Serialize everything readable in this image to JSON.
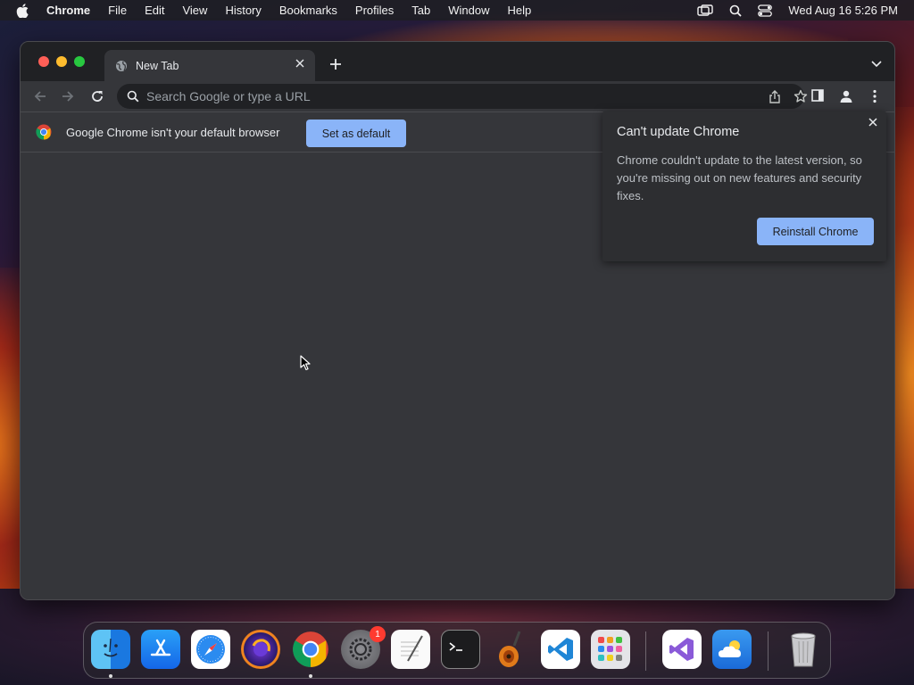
{
  "menubar": {
    "app_name": "Chrome",
    "items": [
      "File",
      "Edit",
      "View",
      "History",
      "Bookmarks",
      "Profiles",
      "Tab",
      "Window",
      "Help"
    ],
    "clock": "Wed Aug 16  5:26 PM"
  },
  "browser": {
    "tab_title": "New Tab",
    "omnibox_placeholder": "Search Google or type a URL"
  },
  "infobar": {
    "message": "Google Chrome isn't your default browser",
    "button": "Set as default"
  },
  "update_popup": {
    "title": "Can't update Chrome",
    "body": "Chrome couldn't update to the latest version, so you're missing out on new features and security fixes.",
    "button": "Reinstall Chrome"
  },
  "dock": {
    "apps": [
      "finder",
      "app-store",
      "safari",
      "firefox",
      "chrome",
      "system-settings",
      "textedit",
      "terminal",
      "garageband",
      "vscode",
      "launchpad",
      "visual-studio",
      "weather",
      "trash"
    ],
    "system_settings_badge": "1"
  },
  "colors": {
    "window_bg": "#35363a",
    "tabstrip_bg": "#202124",
    "accent_blue": "#8ab4f8"
  }
}
